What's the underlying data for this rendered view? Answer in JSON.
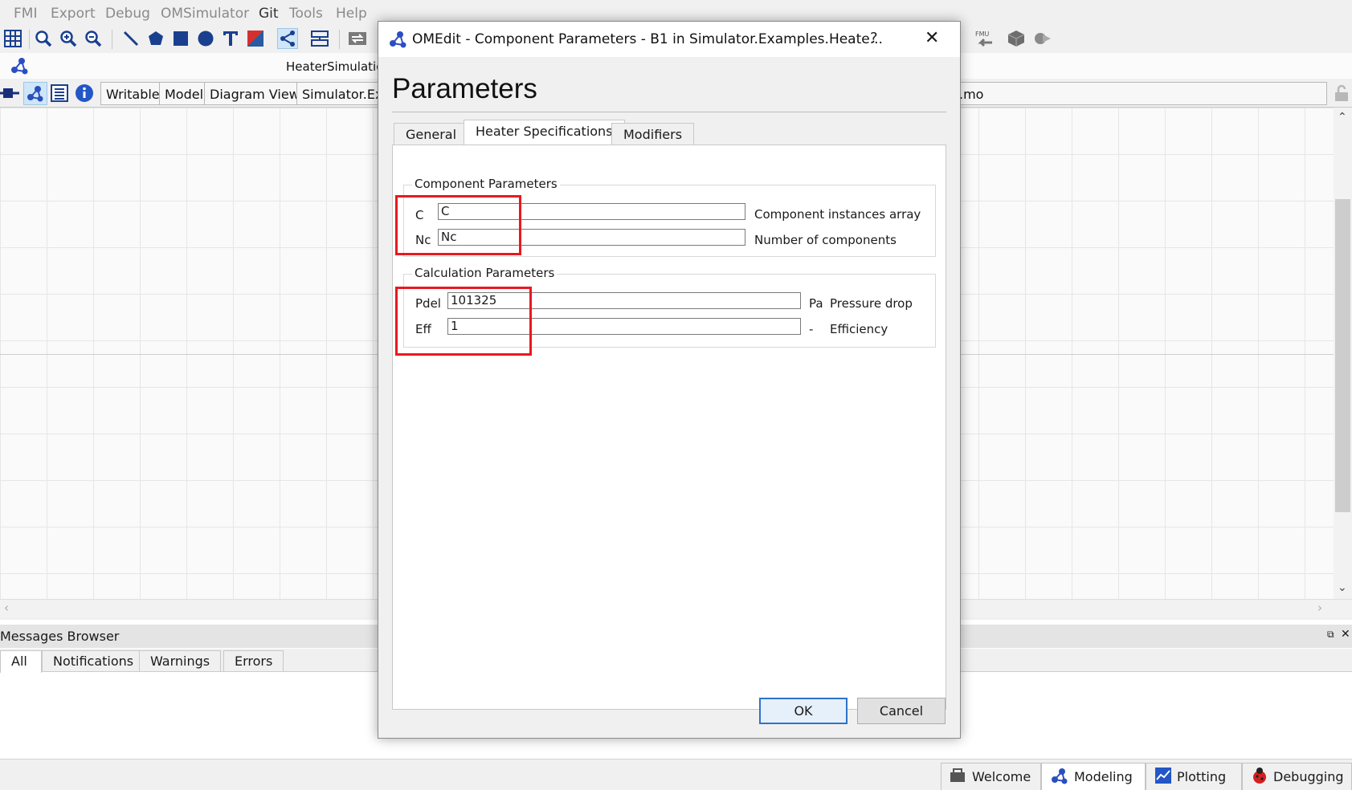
{
  "menu": [
    "FMI",
    "Export",
    "Debug",
    "OMSimulator",
    "Git",
    "Tools",
    "Help"
  ],
  "model_title": "HeaterSimulatio",
  "subtoolbar": {
    "writable": "Writable",
    "model": "Model",
    "view": "Diagram View",
    "path": "Simulator.Exa",
    "file_tail": ".mo"
  },
  "messages": {
    "title": "Messages Browser",
    "tabs": [
      "All",
      "Notifications",
      "Warnings",
      "Errors"
    ]
  },
  "perspectives": [
    "Welcome",
    "Modeling",
    "Plotting",
    "Debugging"
  ],
  "dialog": {
    "title": "OMEdit - Component Parameters - B1 in Simulator.Examples.Heate...",
    "help": "?",
    "heading": "Parameters",
    "tabs": [
      "General",
      "Heater Specifications",
      "Modifiers"
    ],
    "groups": {
      "component": {
        "label": "Component Parameters",
        "params": [
          {
            "name": "C",
            "value": "C",
            "unit": "",
            "desc": "Component instances array"
          },
          {
            "name": "Nc",
            "value": "Nc",
            "unit": "",
            "desc": "Number of components"
          }
        ]
      },
      "calculation": {
        "label": "Calculation Parameters",
        "params": [
          {
            "name": "Pdel",
            "value": "101325",
            "unit": "Pa",
            "desc": "Pressure drop"
          },
          {
            "name": "Eff",
            "value": "1",
            "unit": "-",
            "desc": "Efficiency"
          }
        ]
      }
    },
    "ok": "OK",
    "cancel": "Cancel"
  },
  "colors": {
    "highlight": "#e8191f",
    "accent": "#2d73c9"
  }
}
